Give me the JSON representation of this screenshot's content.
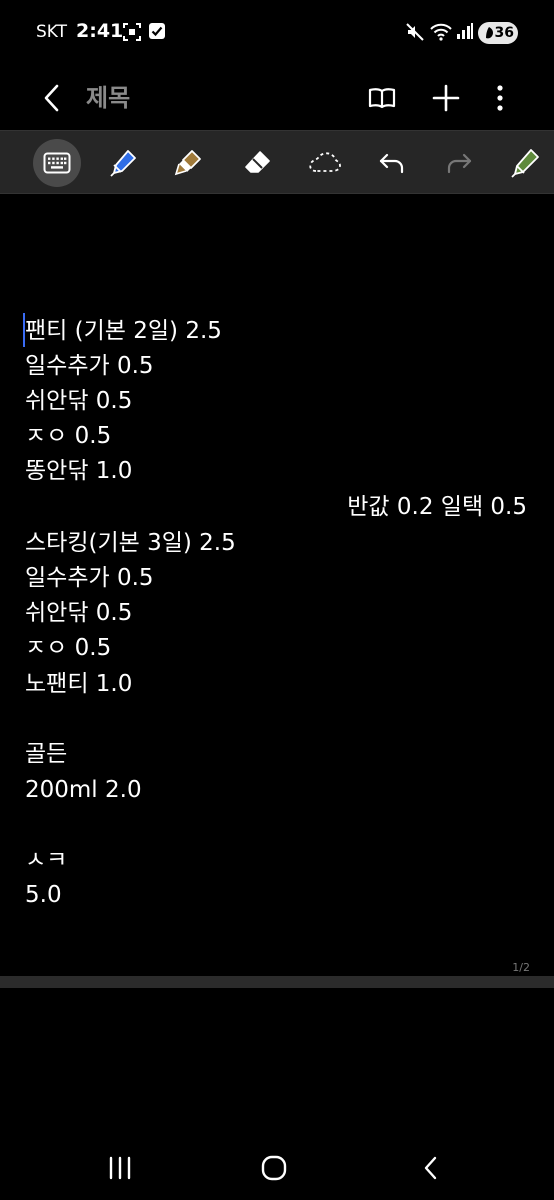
{
  "status_bar": {
    "carrier": "SKT",
    "time": "2:41",
    "battery": "36"
  },
  "header": {
    "title": "제목"
  },
  "toolbar": {
    "tools": [
      {
        "name": "keyboard",
        "active": true
      },
      {
        "name": "pen"
      },
      {
        "name": "highlighter"
      },
      {
        "name": "eraser"
      },
      {
        "name": "lasso"
      },
      {
        "name": "undo"
      },
      {
        "name": "redo"
      },
      {
        "name": "pen-settings"
      }
    ],
    "accent_color": "#3a6cf5"
  },
  "note": {
    "lines": [
      "팬티 (기본 2일) 2.5",
      "일수추가 0.5",
      "쉬안닦 0.5",
      "ㅈㅇ 0.5",
      "똥안닦 1.0",
      "반값 0.2 일택 0.5",
      "스타킹(기본 3일) 2.5",
      "일수추가 0.5",
      "쉬안닦 0.5",
      "ㅈㅇ 0.5",
      "노팬티 1.0",
      "골든",
      "200ml 2.0",
      "ㅅㅋ",
      "5.0"
    ],
    "page_indicator": "1/2"
  }
}
